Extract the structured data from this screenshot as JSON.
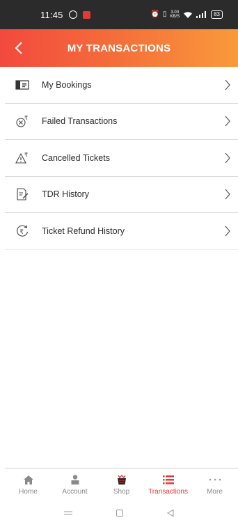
{
  "status_bar": {
    "time": "11:45",
    "speed_top": "3.00",
    "speed_bottom": "KB/S",
    "battery": "83"
  },
  "header": {
    "title": "MY TRANSACTIONS"
  },
  "menu": {
    "items": [
      {
        "label": "My Bookings",
        "icon": "ticket-icon"
      },
      {
        "label": "Failed Transactions",
        "icon": "failed-rupee-icon"
      },
      {
        "label": "Cancelled Tickets",
        "icon": "cancelled-warning-icon"
      },
      {
        "label": "TDR History",
        "icon": "document-edit-icon"
      },
      {
        "label": "Ticket Refund History",
        "icon": "rupee-refund-icon"
      }
    ]
  },
  "bottom_nav": {
    "items": [
      {
        "label": "Home",
        "icon": "home-icon"
      },
      {
        "label": "Account",
        "icon": "person-icon"
      },
      {
        "label": "Shop",
        "icon": "shop-icon"
      },
      {
        "label": "Transactions",
        "icon": "list-icon",
        "active": true
      },
      {
        "label": "More",
        "icon": "more-dots-icon"
      }
    ]
  },
  "colors": {
    "accent": "#e53935",
    "header_start": "#f2493e",
    "header_end": "#f99a3b"
  }
}
